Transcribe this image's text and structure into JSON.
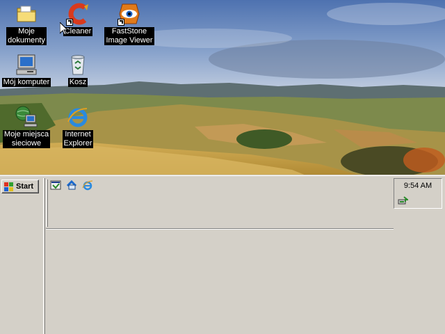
{
  "desktop": {
    "icons": [
      {
        "label": "Moje\ndokumenty",
        "icon": "folder-icon",
        "shortcut": false
      },
      {
        "label": "Cleaner",
        "icon": "cleaner-icon",
        "shortcut": true
      },
      {
        "label": "FastStone\nImage Viewer",
        "icon": "faststone-eye-icon",
        "shortcut": true
      },
      {
        "label": "Mój komputer",
        "icon": "computer-icon",
        "shortcut": false
      },
      {
        "label": "Kosz",
        "icon": "recycle-bin-icon",
        "shortcut": false
      },
      {
        "label": "Moje miejsca\nsieciowe",
        "icon": "network-places-icon",
        "shortcut": false
      },
      {
        "label": "Internet\nExplorer",
        "icon": "internet-explorer-icon",
        "shortcut": false
      }
    ]
  },
  "taskbar": {
    "start_label": "Start",
    "quick_launch": [
      "show-desktop-icon",
      "outlook-express-icon",
      "internet-explorer-icon"
    ],
    "tray": {
      "time": "9:54 AM",
      "icons": [
        "safely-remove-hardware-icon"
      ]
    }
  },
  "colors": {
    "taskbar_bg": "#d4d0c8",
    "label_bg": "#000000",
    "label_fg": "#ffffff",
    "sky": "#5a7db8",
    "field": "#c9a54a"
  }
}
